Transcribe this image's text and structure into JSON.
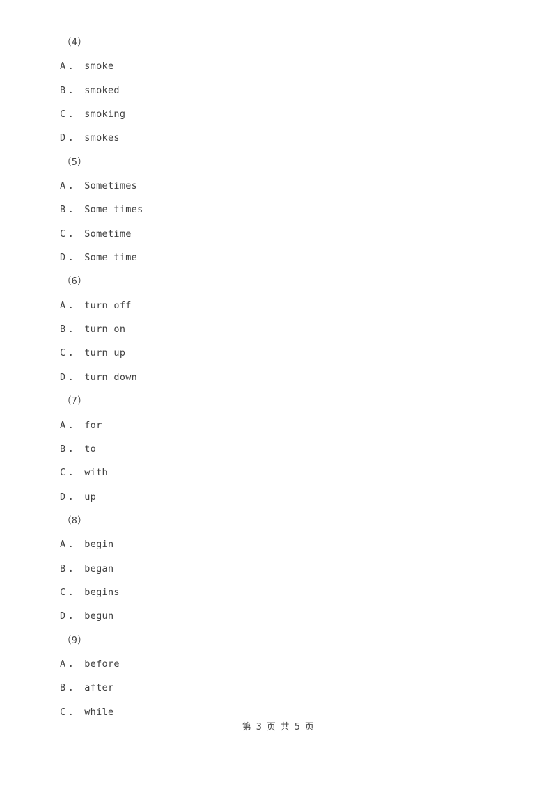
{
  "document": {
    "page_label": "第 3 页 共 5 页",
    "page_current": "3",
    "page_total": "5",
    "background_color": "#ffffff",
    "text_color": "#414141"
  },
  "lines": [
    {
      "kind": "question",
      "text": "（4）"
    },
    {
      "kind": "option",
      "letter": "A",
      "dot": "．",
      "text": "smoke"
    },
    {
      "kind": "option",
      "letter": "B",
      "dot": "．",
      "text": "smoked"
    },
    {
      "kind": "option",
      "letter": "C",
      "dot": "．",
      "text": "smoking"
    },
    {
      "kind": "option",
      "letter": "D",
      "dot": "．",
      "text": "smokes"
    },
    {
      "kind": "question",
      "text": "（5）"
    },
    {
      "kind": "option",
      "letter": "A",
      "dot": "．",
      "text": "Sometimes"
    },
    {
      "kind": "option",
      "letter": "B",
      "dot": "．",
      "text": "Some times"
    },
    {
      "kind": "option",
      "letter": "C",
      "dot": "．",
      "text": "Sometime"
    },
    {
      "kind": "option",
      "letter": "D",
      "dot": "．",
      "text": "Some time"
    },
    {
      "kind": "question",
      "text": "（6）"
    },
    {
      "kind": "option",
      "letter": "A",
      "dot": "．",
      "text": "turn off"
    },
    {
      "kind": "option",
      "letter": "B",
      "dot": "．",
      "text": "turn on"
    },
    {
      "kind": "option",
      "letter": "C",
      "dot": "．",
      "text": "turn up"
    },
    {
      "kind": "option",
      "letter": "D",
      "dot": "．",
      "text": "turn down"
    },
    {
      "kind": "question",
      "text": "（7）"
    },
    {
      "kind": "option",
      "letter": "A",
      "dot": "．",
      "text": "for"
    },
    {
      "kind": "option",
      "letter": "B",
      "dot": "．",
      "text": "to"
    },
    {
      "kind": "option",
      "letter": "C",
      "dot": "．",
      "text": "with"
    },
    {
      "kind": "option",
      "letter": "D",
      "dot": "．",
      "text": "up"
    },
    {
      "kind": "question",
      "text": "（8）"
    },
    {
      "kind": "option",
      "letter": "A",
      "dot": "．",
      "text": "begin"
    },
    {
      "kind": "option",
      "letter": "B",
      "dot": "．",
      "text": "began"
    },
    {
      "kind": "option",
      "letter": "C",
      "dot": "．",
      "text": "begins"
    },
    {
      "kind": "option",
      "letter": "D",
      "dot": "．",
      "text": "begun"
    },
    {
      "kind": "question",
      "text": "（9）"
    },
    {
      "kind": "option",
      "letter": "A",
      "dot": "．",
      "text": "before"
    },
    {
      "kind": "option",
      "letter": "B",
      "dot": "．",
      "text": "after"
    },
    {
      "kind": "option",
      "letter": "C",
      "dot": "．",
      "text": "while"
    }
  ]
}
